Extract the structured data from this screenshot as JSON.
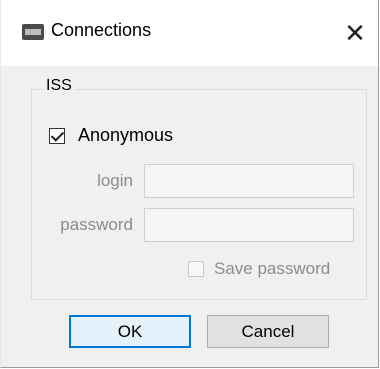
{
  "window": {
    "title": "Connections",
    "app_icon": "app-window-icon",
    "close_icon": "close-icon",
    "close_glyph": "✕"
  },
  "group": {
    "title": "ISS",
    "anonymous": {
      "label": "Anonymous",
      "checked": true
    },
    "login": {
      "label": "login",
      "value": ""
    },
    "password": {
      "label": "password",
      "value": ""
    },
    "save_password": {
      "label": "Save password",
      "checked": false
    }
  },
  "buttons": {
    "ok": "OK",
    "cancel": "Cancel"
  },
  "colors": {
    "accent": "#0078d7",
    "disabled_text": "#8c8c8c",
    "dialog_bg": "#f0f0f0"
  }
}
